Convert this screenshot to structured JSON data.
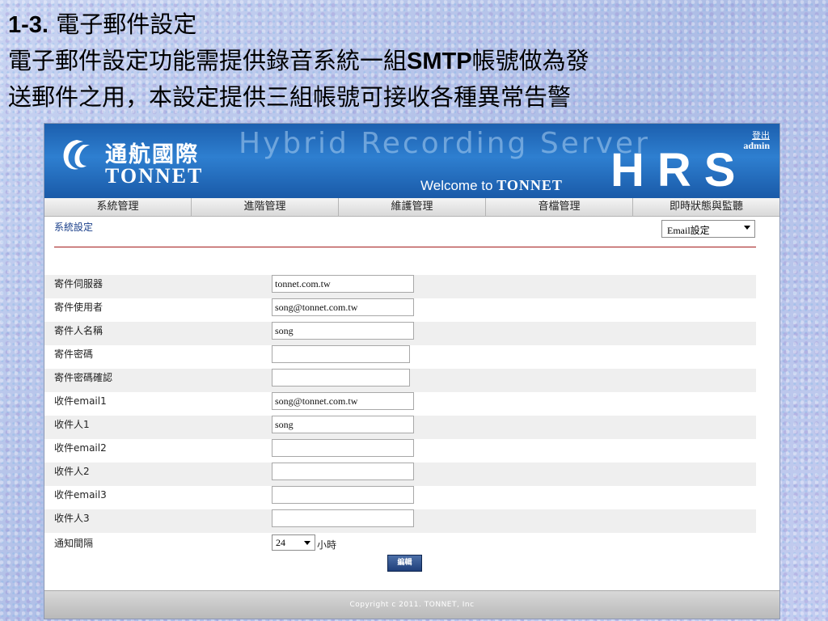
{
  "slide": {
    "number": "1-3.",
    "heading": "電子郵件設定",
    "desc_part1": "電子郵件設定功能需提供錄音系統一組",
    "desc_smtp": "SMTP",
    "desc_part2": "帳號做為發",
    "desc_line2": "送郵件之用，本設定提供三組帳號可接收各種異常告警"
  },
  "header": {
    "logo_cn": "通航國際",
    "logo_en": "TONNET",
    "product": "Hybrid Recording Server",
    "welcome": "Welcome to",
    "welcome_brand": "TONNET",
    "hrs": "HRS",
    "logout": "登出",
    "user": "admin"
  },
  "menu": [
    {
      "label": "系統管理"
    },
    {
      "label": "進階管理"
    },
    {
      "label": "維護管理"
    },
    {
      "label": "音檔管理"
    },
    {
      "label": "即時狀態與監聽"
    }
  ],
  "breadcrumb": "系統設定",
  "section_select": {
    "selected": "Email設定"
  },
  "form": {
    "rows": [
      {
        "label": "寄件伺服器",
        "value": "tonnet.com.tw"
      },
      {
        "label": "寄件使用者",
        "value": "song@tonnet.com.tw"
      },
      {
        "label": "寄件人名稱",
        "value": "song"
      },
      {
        "label": "寄件密碼",
        "value": ""
      },
      {
        "label": "寄件密碼確認",
        "value": ""
      },
      {
        "label": "收件email1",
        "value": "song@tonnet.com.tw"
      },
      {
        "label": "收件人1",
        "value": "song"
      },
      {
        "label": "收件email2",
        "value": ""
      },
      {
        "label": "收件人2",
        "value": ""
      },
      {
        "label": "收件email3",
        "value": ""
      },
      {
        "label": "收件人3",
        "value": ""
      }
    ],
    "interval_label": "通知間隔",
    "interval_value": "24",
    "interval_unit": "小時",
    "edit_button": "編輯"
  },
  "footer": "Copyright c 2011. TONNET, Inc",
  "colors": {
    "banner": "#1c5fae",
    "rule": "#a31a1a",
    "button": "#1f3f7a"
  }
}
